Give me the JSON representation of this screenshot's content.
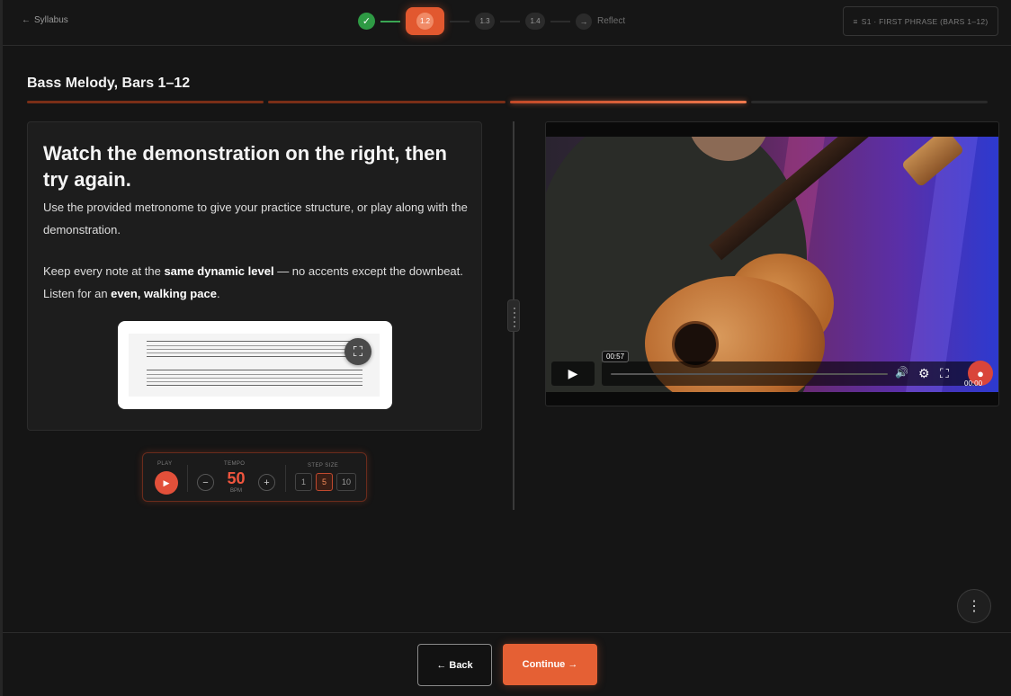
{
  "header": {
    "back_label": "Syllabus",
    "back_arrow": "←",
    "steps": [
      {
        "label": "✓",
        "state": "done"
      },
      {
        "label": "1.2",
        "state": "active"
      },
      {
        "label": "1.3",
        "state": "upcoming"
      },
      {
        "label": "1.4",
        "state": "upcoming"
      },
      {
        "label": "Reflect",
        "icon": "→",
        "state": "upcoming"
      }
    ],
    "section_icon": "≡",
    "section_label": "S1 · FIRST PHRASE (BARS 1–12)"
  },
  "lesson": {
    "title": "Bass Melody, Bars 1–12",
    "progress": {
      "segments": 4,
      "completed": 2,
      "current": 3
    }
  },
  "card": {
    "heading": "Watch the demonstration on the right, then try again.",
    "para1": "Use the provided metronome to give your practice structure, or play along with the demonstration.",
    "para2_a": "Keep every note at the ",
    "para2_b": "same dynamic level",
    "para2_c": " — no accents except the downbeat. Listen for an ",
    "para2_d": "even, walking pace",
    "para2_e": ".",
    "fullscreen_icon": "⛶"
  },
  "metronome": {
    "play_label": "PLAY",
    "play_icon": "▶",
    "tempo_label": "TEMPO",
    "tempo_value": "50",
    "tempo_unit": "BPM",
    "minus": "−",
    "plus": "+",
    "step_size_label": "STEP SIZE",
    "step_sizes": [
      "1",
      "5",
      "10"
    ],
    "selected_step": "5"
  },
  "video": {
    "play_icon": "▶",
    "tooltip_time": "00:57",
    "volume_icon": "🔊",
    "settings_icon": "⚙",
    "fullscreen_icon": "⛶",
    "time": "00:00",
    "playback_progress": 0
  },
  "footer": {
    "back_label": "← Back",
    "continue_label": "Continue →",
    "more_icon": "⋮"
  },
  "colors": {
    "accent": "#e56034",
    "success": "#2e9a44",
    "background": "#151515"
  }
}
